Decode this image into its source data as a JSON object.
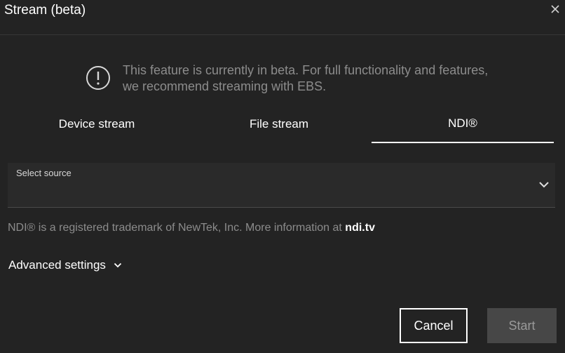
{
  "dialog": {
    "title": "Stream (beta)",
    "close_icon": "close-icon"
  },
  "notice": {
    "icon": "info-circle-icon",
    "text": "This feature is currently in beta. For full functionality and features, we recommend streaming with EBS."
  },
  "tabs": [
    {
      "label": "Device stream",
      "active": false
    },
    {
      "label": "File stream",
      "active": false
    },
    {
      "label": "NDI®",
      "active": true
    }
  ],
  "source_select": {
    "label": "Select source",
    "value": "",
    "icon": "chevron-down-icon"
  },
  "ndi_note": {
    "text": "NDI® is a registered trademark of NewTek, Inc. More information at ",
    "link_label": "ndi.tv"
  },
  "advanced": {
    "label": "Advanced settings",
    "icon": "chevron-down-icon"
  },
  "buttons": {
    "cancel": "Cancel",
    "start": "Start"
  },
  "colors": {
    "background": "#232323",
    "muted_text": "#8c8c8c",
    "disabled_button": "#474747"
  }
}
